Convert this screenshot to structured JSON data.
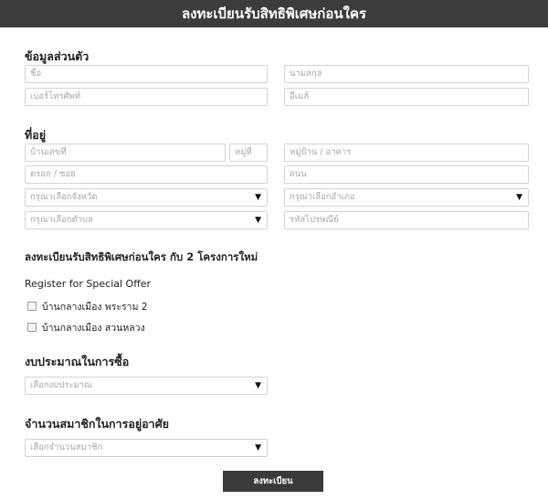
{
  "header": {
    "title": "ลงทะเบียนรับสิทธิพิเศษก่อนใคร"
  },
  "personal": {
    "title": "ข้อมูลส่วนตัว",
    "first_name_placeholder": "ชื่อ",
    "last_name_placeholder": "นามสกุล",
    "phone_placeholder": "เบอร์โทรศัพท์",
    "email_placeholder": "อีเมล์"
  },
  "address": {
    "title": "ที่อยู่",
    "house_no_placeholder": "บ้านเลขที่",
    "moo_placeholder": "หมู่ที่",
    "village_placeholder": "หมู่บ้าน / อาคาร",
    "soi_placeholder": "ตรอก / ซอย",
    "road_placeholder": "ถนน",
    "province_select": "กรุณาเลือกจังหวัด",
    "district_select": "กรุณาเลือกอำเภอ",
    "subdistrict_select": "กรุณาเลือกตำบล",
    "postcode_placeholder": "รหัสไปรษณีย์"
  },
  "offer": {
    "title": "ลงทะเบียนรับสิทธิพิเศษก่อนใคร กับ 2 โครงการใหม่",
    "subtitle": "Register for Special Offer",
    "projects": [
      "บ้านกลางเมือง พระราม 2",
      "บ้านกลางเมือง สวนหลวง"
    ]
  },
  "budget": {
    "title": "งบประมาณในการซื้อ",
    "select": "เลือกงบประมาณ"
  },
  "members": {
    "title": "จำนวนสมาชิกในการอยู่อาศัย",
    "select": "เลือกจำนวนสมาชิก"
  },
  "submit": {
    "label": "ลงทะเบียน"
  },
  "icons": {
    "dropdown_arrow": "▼"
  }
}
